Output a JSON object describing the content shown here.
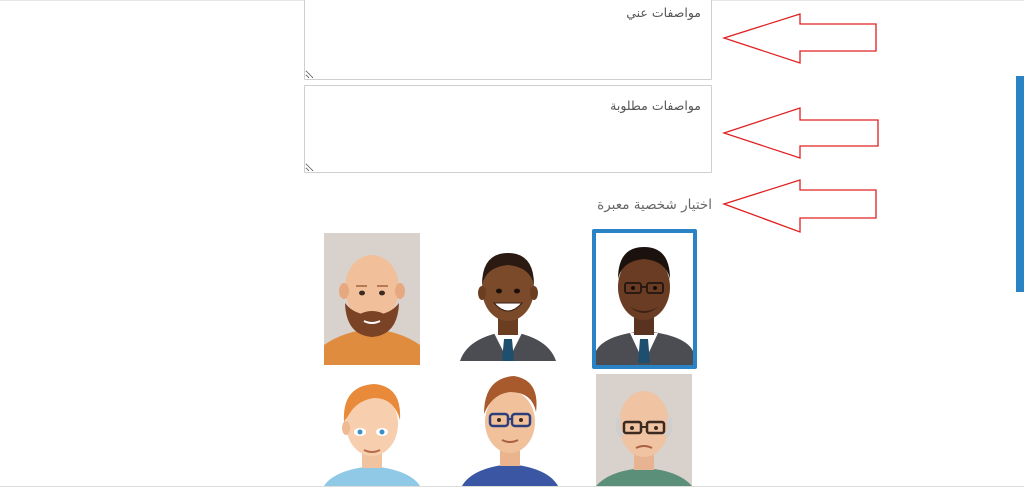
{
  "form": {
    "about_me_placeholder": "مواصفات عني",
    "required_specs_placeholder": "مواصفات مطلوبة",
    "avatar_section_label": "اختيار شخصية معبرة"
  },
  "avatars": [
    {
      "name": "avatar-bald-beard",
      "selected": false
    },
    {
      "name": "avatar-smiling-man",
      "selected": false
    },
    {
      "name": "avatar-glasses-suit",
      "selected": true
    },
    {
      "name": "avatar-redhead",
      "selected": false
    },
    {
      "name": "avatar-glasses-brown-hair",
      "selected": false
    },
    {
      "name": "avatar-old-glasses",
      "selected": false
    }
  ],
  "colors": {
    "accent": "#2a83c4",
    "arrow": "#e02020"
  }
}
